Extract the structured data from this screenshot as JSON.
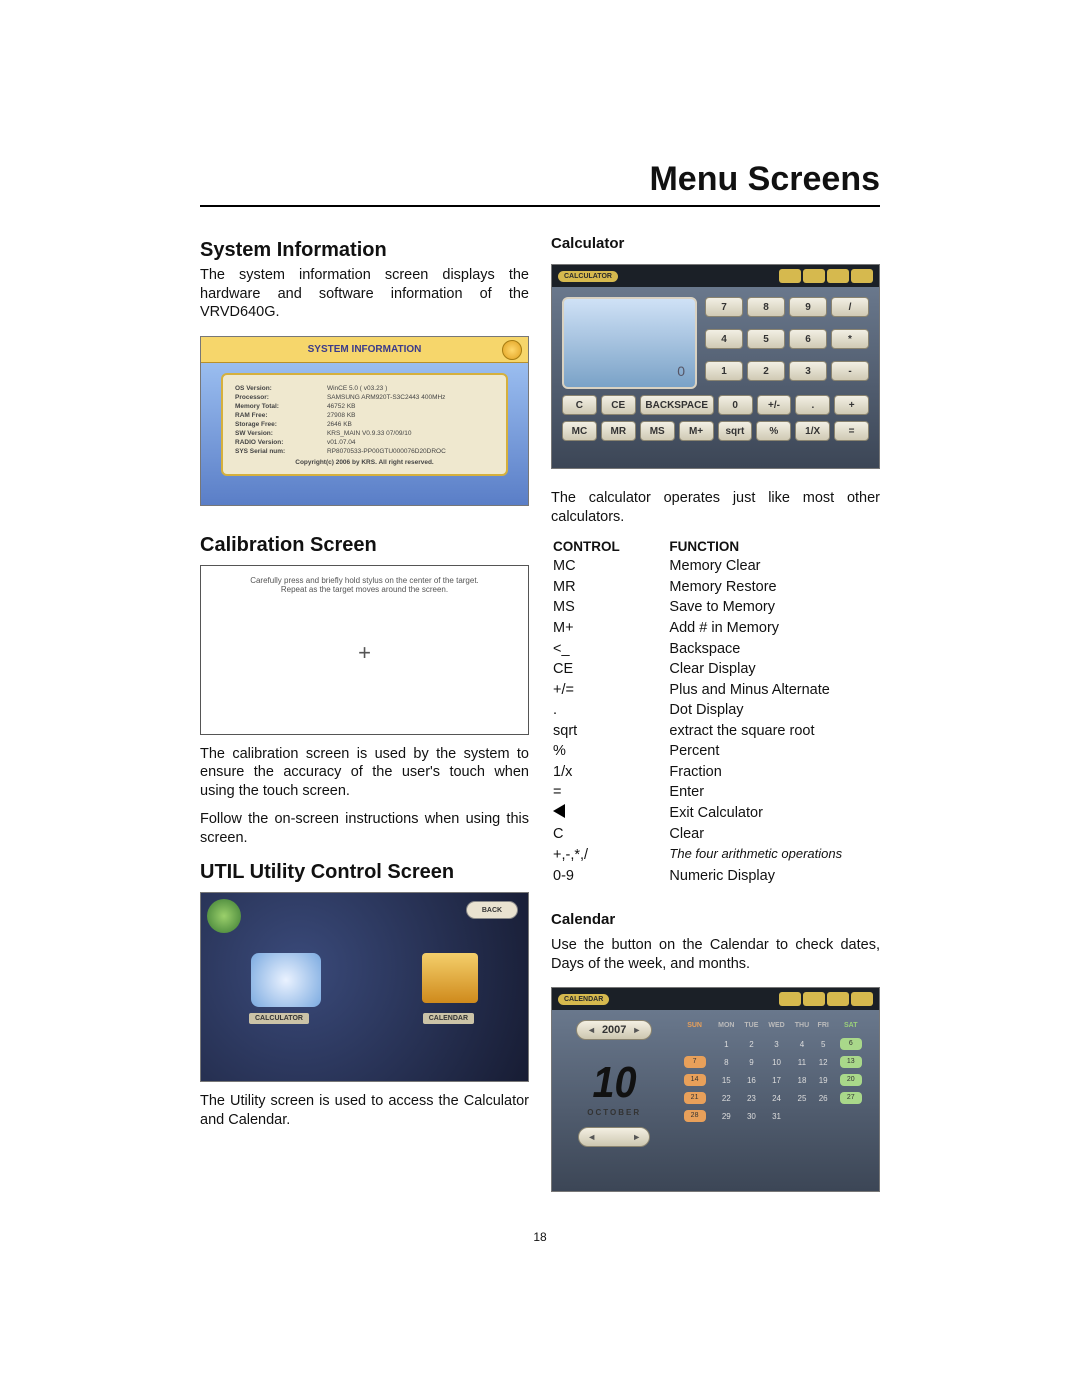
{
  "page_title": "Menu Screens",
  "page_number": "18",
  "left": {
    "sysinfo_heading": "System Information",
    "sysinfo_para": "The system information screen displays the hardware and software information of the VRVD640G.",
    "sysinfo_bar": "SYSTEM INFORMATION",
    "sysinfo_rows": [
      {
        "k": "OS Version:",
        "v": "WinCE 5.0 ( v03.23 )"
      },
      {
        "k": "Processor:",
        "v": "SAMSUNG ARM920T-S3C2443 400MHz"
      },
      {
        "k": "Memory Total:",
        "v": "46752 KB"
      },
      {
        "k": "RAM Free:",
        "v": "27908 KB"
      },
      {
        "k": "Storage Free:",
        "v": "2646 KB"
      },
      {
        "k": "SW Version:",
        "v": "KRS_MAIN V0.9.33 07/09/10"
      },
      {
        "k": "RADIO Version:",
        "v": "v01.07.04"
      },
      {
        "k": "SYS Serial num:",
        "v": "RP8070533-PP00GTU000076D20DROC"
      }
    ],
    "sysinfo_foot": "Copyright(c) 2006 by KRS. All right reserved.",
    "calib_heading": "Calibration Screen",
    "calib_text1": "Carefully press and briefly hold stylus on the center of the target.",
    "calib_text2": "Repeat as the target moves around the screen.",
    "calib_para": "The calibration screen is used by the system to ensure the accuracy of the user's touch when using the touch screen.",
    "calib_para2": "Follow the on-screen instructions when using this screen.",
    "util_heading": "UTIL Utility Control Screen",
    "util_back": "BACK",
    "util_label1": "CALCULATOR",
    "util_label2": "CALENDAR",
    "util_para": "The Utility screen is used to access the Calculator and Calendar."
  },
  "right": {
    "calc_heading": "Calculator",
    "calc_tag": "CALCULATOR",
    "calc_display": "0",
    "calc_keys_top": [
      "7",
      "8",
      "9",
      "/",
      "4",
      "5",
      "6",
      "*",
      "1",
      "2",
      "3",
      "-"
    ],
    "calc_row_a": [
      "C",
      "CE",
      "BACKSPACE",
      "0",
      "+/-",
      ".",
      "+"
    ],
    "calc_row_b": [
      "MC",
      "MR",
      "MS",
      "M+",
      "sqrt",
      "%",
      "1/X",
      "="
    ],
    "calc_para": "The calculator operates just like most other calculators.",
    "table_head": {
      "c": "CONTROL",
      "f": "FUNCTION"
    },
    "table_rows": [
      {
        "c": "MC",
        "f": "Memory Clear"
      },
      {
        "c": "MR",
        "f": "Memory Restore"
      },
      {
        "c": "MS",
        "f": "Save to Memory"
      },
      {
        "c": "M+",
        "f": "Add # in Memory"
      },
      {
        "c": "<_",
        "f": "Backspace"
      },
      {
        "c": "CE",
        "f": "Clear Display"
      },
      {
        "c": "+/=",
        "f": "Plus and Minus Alternate"
      },
      {
        "c": ".",
        "f": "Dot Display"
      },
      {
        "c": "sqrt",
        "f": "extract the square root"
      },
      {
        "c": "%",
        "f": "Percent"
      },
      {
        "c": "1/x",
        "f": "Fraction"
      },
      {
        "c": "=",
        "f": "Enter"
      },
      {
        "c": "__TRI__",
        "f": "Exit Calculator"
      },
      {
        "c": "C",
        "f": "Clear"
      },
      {
        "c": "+,-,*,/",
        "f": "The four arithmetic operations",
        "italic": true
      },
      {
        "c": "0-9",
        "f": "Numeric Display"
      }
    ],
    "calendar_heading": "Calendar",
    "calendar_para": "Use the button on the Calendar to check dates, Days of the week, and months.",
    "cal_tag": "CALENDAR",
    "cal_year": "2007",
    "cal_big": "10",
    "cal_month": "OCTOBER",
    "cal_dow": [
      "SUN",
      "MON",
      "TUE",
      "WED",
      "THU",
      "FRI",
      "SAT"
    ],
    "cal_grid": [
      [
        "",
        "1",
        "2",
        "3",
        "4",
        "5",
        "6"
      ],
      [
        "7",
        "8",
        "9",
        "10",
        "11",
        "12",
        "13"
      ],
      [
        "14",
        "15",
        "16",
        "17",
        "18",
        "19",
        "20"
      ],
      [
        "21",
        "22",
        "23",
        "24",
        "25",
        "26",
        "27"
      ],
      [
        "28",
        "29",
        "30",
        "31",
        "",
        "",
        ""
      ]
    ]
  }
}
